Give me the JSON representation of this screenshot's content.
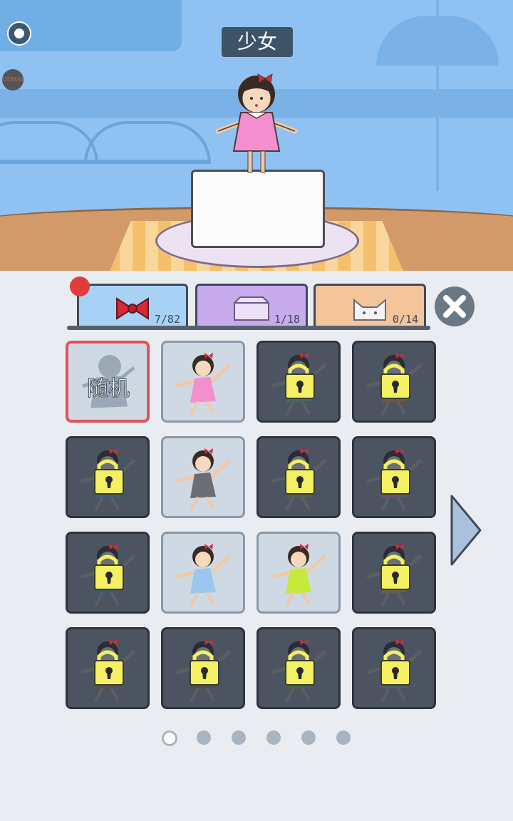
{
  "character_name": "少女",
  "debug_label": "DEBUG",
  "tabs": [
    {
      "name": "accessory",
      "count": "7/82",
      "color": "#a8d2f5",
      "icon": "bow-icon"
    },
    {
      "name": "pedestal",
      "count": "1/18",
      "color": "#c8abec",
      "icon": "box-icon"
    },
    {
      "name": "pet",
      "count": "0/14",
      "color": "#f4c49a",
      "icon": "cat-icon"
    }
  ],
  "random_label": "随机",
  "grid": [
    {
      "state": "random"
    },
    {
      "state": "unlocked",
      "outfit": "pink dress",
      "dress_color": "#f48fcf"
    },
    {
      "state": "locked",
      "dress_color": "#3e7b62"
    },
    {
      "state": "locked",
      "dress_color": "#8a5a3a"
    },
    {
      "state": "locked",
      "dress_color": "#3a6a8a"
    },
    {
      "state": "unlocked",
      "outfit": "gray dress with glasses",
      "dress_color": "#6c6c74"
    },
    {
      "state": "locked",
      "dress_color": "#5a6a4a"
    },
    {
      "state": "locked",
      "dress_color": "#7a5a6a"
    },
    {
      "state": "locked",
      "dress_color": "#3a5a7a"
    },
    {
      "state": "unlocked",
      "outfit": "blue striped dress",
      "dress_color": "#9cc6ee"
    },
    {
      "state": "unlocked",
      "outfit": "green floral dress",
      "dress_color": "#c6ea3a"
    },
    {
      "state": "locked",
      "dress_color": "#7a6a3a"
    },
    {
      "state": "locked",
      "dress_color": "#6a4a3a"
    },
    {
      "state": "locked",
      "dress_color": "#5a4a3a"
    },
    {
      "state": "locked",
      "dress_color": "#4a6a3a"
    },
    {
      "state": "locked",
      "dress_color": "#5a6470"
    }
  ],
  "pages": {
    "total": 6,
    "current": 1
  },
  "colors": {
    "lock": "#f3f063",
    "accent_red": "#e0525a"
  }
}
